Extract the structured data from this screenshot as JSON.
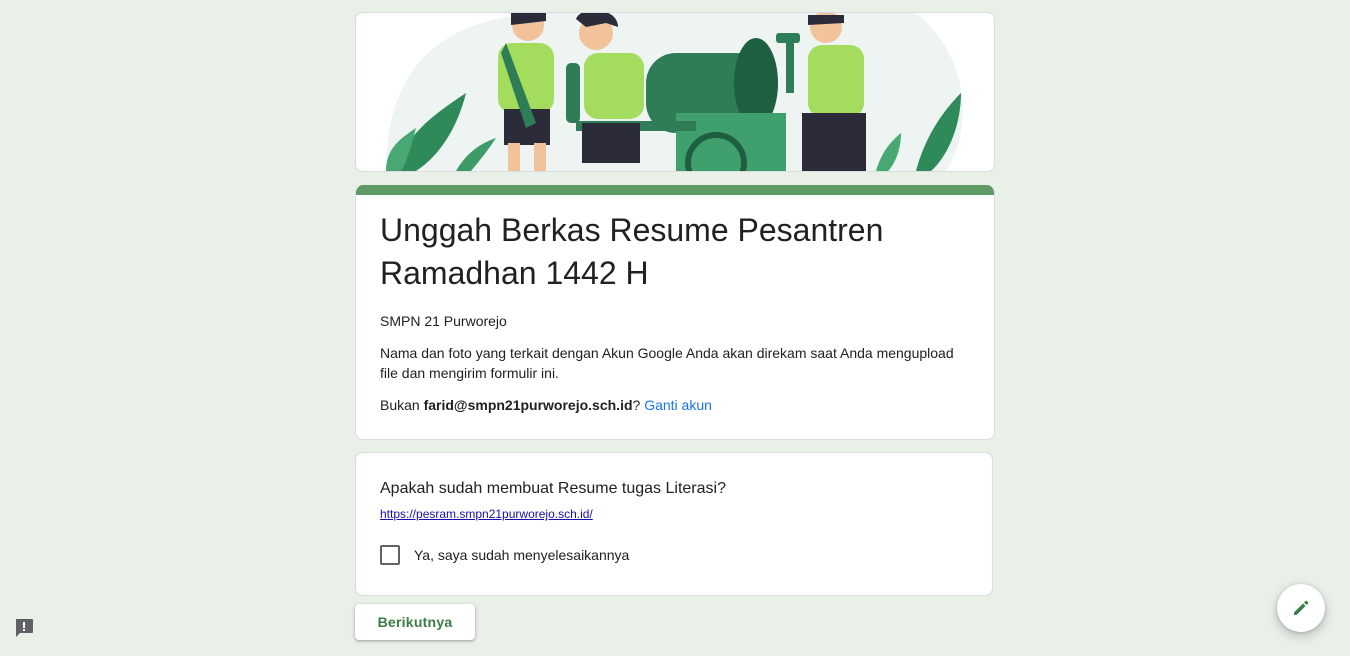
{
  "header": {
    "image_name": "banner-illustration"
  },
  "form": {
    "title": "Unggah Berkas Resume Pesantren Ramadhan 1442 H",
    "subtitle": "SMPN 21 Purworejo",
    "notice": "Nama dan foto yang terkait dengan Akun Google Anda akan direkam saat Anda mengupload file dan mengirim formulir ini.",
    "email_prefix": "Bukan ",
    "email": "farid@smpn21purworejo.sch.id",
    "email_suffix": "?",
    "switch_account": "Ganti akun"
  },
  "question": {
    "title": "Apakah sudah membuat Resume tugas Literasi?",
    "link": "https://pesram.smpn21purworejo.sch.id/",
    "option_label": "Ya, saya sudah menyelesaikannya",
    "checked": false
  },
  "buttons": {
    "next_label": "Berikutnya"
  },
  "icons": {
    "report": "report-problem-icon",
    "edit": "pencil-icon"
  },
  "colors": {
    "accent": "#5e9a64",
    "link": "#1a73e8",
    "button_text": "#3a7d44",
    "background": "#e8f0e8"
  }
}
